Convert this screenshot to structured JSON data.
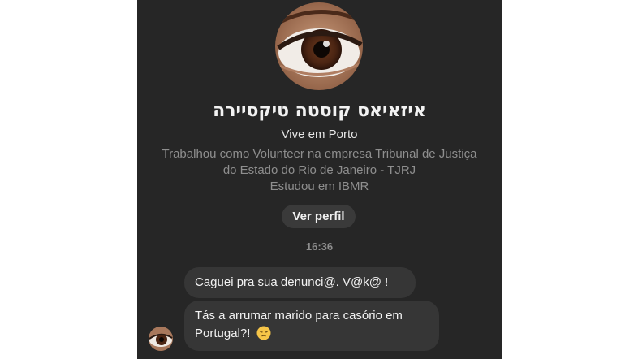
{
  "profile": {
    "name": "איזאיאס קוסטה טיקסיירה",
    "lives": "Vive em Porto",
    "work": "Trabalhou como Volunteer na empresa Tribunal de Justiça do Estado do Rio de Janeiro - TJRJ",
    "study": "Estudou em IBMR",
    "view_profile_label": "Ver perfil",
    "avatar_icon": "eye-photo"
  },
  "chat": {
    "timestamp": "16:36",
    "messages": [
      {
        "text": "Caguei pra sua denunci@. V@k@ !"
      },
      {
        "text": "Tás a arrumar marido para casório em Portugal?!",
        "emoji": "pensive-face"
      }
    ]
  },
  "colors": {
    "background": "#262626",
    "bubble": "#363636",
    "button": "#3a3a3a",
    "muted_text": "#8e8e8e"
  }
}
